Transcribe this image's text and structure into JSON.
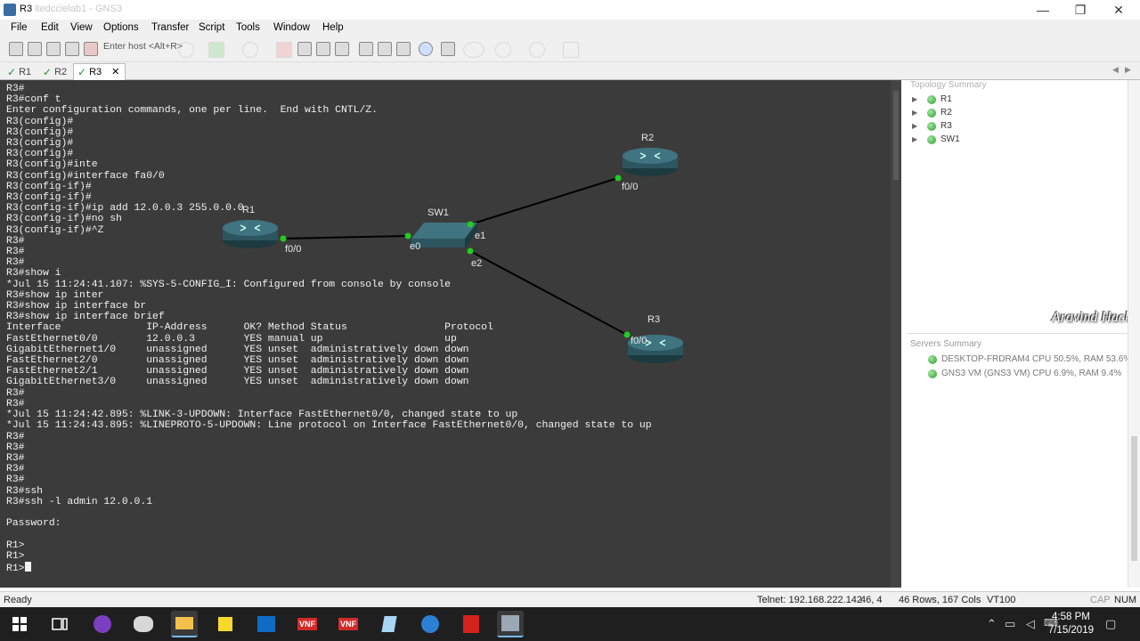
{
  "window": {
    "title": "R3",
    "title_faint": "ltedccielab1 - GNS3",
    "controls": {
      "minimize": "—",
      "maximize": "❐",
      "close": "✕"
    }
  },
  "menu": [
    "File",
    "Edit",
    "View",
    "Options",
    "Transfer",
    "Script",
    "Tools",
    "Window",
    "Help"
  ],
  "toolbar": {
    "host_placeholder": "Enter host <Alt+R>"
  },
  "tabs": [
    {
      "label": "R1",
      "active": false
    },
    {
      "label": "R2",
      "active": false
    },
    {
      "label": "R3",
      "active": true,
      "close": "✕"
    }
  ],
  "terminal": {
    "lines": [
      "R3#",
      "R3#conf t",
      "Enter configuration commands, one per line.  End with CNTL/Z.",
      "R3(config)#",
      "R3(config)#",
      "R3(config)#",
      "R3(config)#",
      "R3(config)#inte",
      "R3(config)#interface fa0/0",
      "R3(config-if)#",
      "R3(config-if)#",
      "R3(config-if)#ip add 12.0.0.3 255.0.0.0",
      "R3(config-if)#no sh",
      "R3(config-if)#^Z",
      "R3#",
      "R3#",
      "R3#",
      "R3#show i",
      "*Jul 15 11:24:41.107: %SYS-5-CONFIG_I: Configured from console by console",
      "R3#show ip inter",
      "R3#show ip interface br",
      "R3#show ip interface brief",
      "Interface              IP-Address      OK? Method Status                Protocol",
      "FastEthernet0/0        12.0.0.3        YES manual up                    up",
      "GigabitEthernet1/0     unassigned      YES unset  administratively down down",
      "FastEthernet2/0        unassigned      YES unset  administratively down down",
      "FastEthernet2/1        unassigned      YES unset  administratively down down",
      "GigabitEthernet3/0     unassigned      YES unset  administratively down down",
      "R3#",
      "R3#",
      "*Jul 15 11:24:42.895: %LINK-3-UPDOWN: Interface FastEthernet0/0, changed state to up",
      "*Jul 15 11:24:43.895: %LINEPROTO-5-UPDOWN: Line protocol on Interface FastEthernet0/0, changed state to up",
      "R3#",
      "R3#",
      "R3#",
      "R3#",
      "R3#",
      "R3#ssh",
      "R3#ssh -l admin 12.0.0.1",
      "",
      "Password:",
      "",
      "R1>",
      "R1>"
    ],
    "prompt": "R1>"
  },
  "topology": {
    "nodes": [
      {
        "name": "R1",
        "type": "router",
        "port": "f0/0"
      },
      {
        "name": "SW1",
        "type": "switch",
        "ports": [
          "e0",
          "e1",
          "e2"
        ]
      },
      {
        "name": "R2",
        "type": "router",
        "port": "f0/0"
      },
      {
        "name": "R3",
        "type": "router",
        "port": "f0/0"
      }
    ]
  },
  "right_panel": {
    "topology_summary_title": "Topology Summary",
    "topology_items": [
      "R1",
      "R2",
      "R3",
      "SW1"
    ],
    "servers_summary_title": "Servers Summary",
    "servers": [
      "DESKTOP-FRDRAM4 CPU 50.5%, RAM 53.6%",
      "GNS3 VM (GNS3 VM) CPU 6.9%, RAM 9.4%"
    ],
    "watermark": "Aravind Hack"
  },
  "status": {
    "ready": "Ready",
    "connection": "Telnet: 192.168.222.142",
    "cursor_pos": "46,  4",
    "size": "46 Rows, 167 Cols",
    "term_type": "VT100",
    "caps": "CAP",
    "num": "NUM"
  },
  "taskbar": {
    "time": "4:58 PM",
    "date": "7/15/2019",
    "app_labels": [
      "VNF",
      "VNF"
    ]
  },
  "colors": {
    "terminal_bg": "#3b3b3b",
    "terminal_fg": "#f2f2f2",
    "link_endpoint": "#22cc22",
    "node_status": "#2e9a2e",
    "taskbar": "#1f1f1f"
  }
}
